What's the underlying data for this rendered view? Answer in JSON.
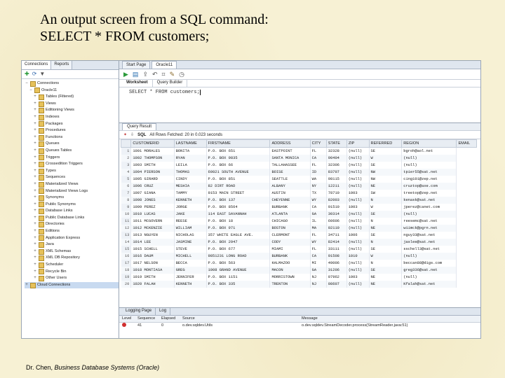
{
  "slide": {
    "title_line1": "An output screen from a SQL command:",
    "title_line2": "SELECT * FROM customers;",
    "footer_author": "Dr. Chen, ",
    "footer_book": "Business Database Systems (Oracle)"
  },
  "left_pane": {
    "tabs": [
      "Connections",
      "Reports"
    ],
    "tree": [
      {
        "label": "Connections",
        "depth": 0,
        "exp": "−"
      },
      {
        "label": "Oracle11",
        "depth": 1,
        "exp": "−"
      },
      {
        "label": "Tables (Filtered)",
        "depth": 2,
        "exp": "+"
      },
      {
        "label": "Views",
        "depth": 2,
        "exp": "+"
      },
      {
        "label": "Editioning Views",
        "depth": 2,
        "exp": "+"
      },
      {
        "label": "Indexes",
        "depth": 2,
        "exp": "+"
      },
      {
        "label": "Packages",
        "depth": 2,
        "exp": "+"
      },
      {
        "label": "Procedures",
        "depth": 2,
        "exp": "+"
      },
      {
        "label": "Functions",
        "depth": 2,
        "exp": "+"
      },
      {
        "label": "Queues",
        "depth": 2,
        "exp": "+"
      },
      {
        "label": "Queues Tables",
        "depth": 2,
        "exp": "+"
      },
      {
        "label": "Triggers",
        "depth": 2,
        "exp": "+"
      },
      {
        "label": "Crossedition Triggers",
        "depth": 2,
        "exp": "+"
      },
      {
        "label": "Types",
        "depth": 2,
        "exp": "+"
      },
      {
        "label": "Sequences",
        "depth": 2,
        "exp": "+"
      },
      {
        "label": "Materialized Views",
        "depth": 2,
        "exp": "+"
      },
      {
        "label": "Materialized Views Logs",
        "depth": 2,
        "exp": "+"
      },
      {
        "label": "Synonyms",
        "depth": 2,
        "exp": "+"
      },
      {
        "label": "Public Synonyms",
        "depth": 2,
        "exp": "+"
      },
      {
        "label": "Database Links",
        "depth": 2,
        "exp": "+"
      },
      {
        "label": "Public Database Links",
        "depth": 2,
        "exp": "+"
      },
      {
        "label": "Directories",
        "depth": 2,
        "exp": "+"
      },
      {
        "label": "Editions",
        "depth": 2,
        "exp": "+"
      },
      {
        "label": "Application Express",
        "depth": 2,
        "exp": "+"
      },
      {
        "label": "Java",
        "depth": 2,
        "exp": "+"
      },
      {
        "label": "XML Schemas",
        "depth": 2,
        "exp": "+"
      },
      {
        "label": "XML DB Repository",
        "depth": 2,
        "exp": "+"
      },
      {
        "label": "Scheduler",
        "depth": 2,
        "exp": "+"
      },
      {
        "label": "Recycle Bin",
        "depth": 2,
        "exp": "+"
      },
      {
        "label": "Other Users",
        "depth": 2,
        "exp": "+"
      },
      {
        "label": "Cloud Connections",
        "depth": 0,
        "exp": "+",
        "selected": true
      }
    ]
  },
  "right_pane": {
    "tabs": [
      "Start Page",
      "Oracle11"
    ],
    "worksheet_tabs": [
      "Worksheet",
      "Query Builder"
    ],
    "sql_text": "SELECT * FROM customers;",
    "result_tab": "Query Result",
    "result_toolbar": {
      "sql_label": "SQL",
      "status": "All Rows Fetched: 20 in 0.023 seconds"
    },
    "columns": [
      "CUSTOMERID",
      "LASTNAME",
      "FIRSTNAME",
      "ADDRESS",
      "CITY",
      "STATE",
      "ZIP",
      "REFERRED",
      "REGION",
      "EMAIL"
    ],
    "rows": [
      [
        "1",
        "1001 MORALES",
        "BONITA",
        "P.O. BOX 651",
        "EASTPOINT",
        "FL",
        "32328",
        "(null)",
        "SE",
        "bgroh@aol.net"
      ],
      [
        "2",
        "1002 THOMPSON",
        "RYAN",
        "P.O. BOX 9835",
        "SANTA MONICA",
        "CA",
        "90404",
        "(null)",
        "W",
        "(null)"
      ],
      [
        "3",
        "1003 SMITH",
        "LEILA",
        "P.O. BOX 66",
        "TALLAHASSEE",
        "FL",
        "32306",
        "(null)",
        "SE",
        "(null)"
      ],
      [
        "4",
        "1004 PIERSON",
        "THOMAS",
        "69821 SOUTH AVENUE",
        "BOISE",
        "ID",
        "83707",
        "(null)",
        "NW",
        "tpier55@sat.net"
      ],
      [
        "5",
        "1005 GIRARD",
        "CINDY",
        "P.O. BOX 851",
        "SEATTLE",
        "WA",
        "98115",
        "(null)",
        "NW",
        "cing101@zep.net"
      ],
      [
        "6",
        "1006 CRUZ",
        "MESHIA",
        "82 DIRT ROAD",
        "ALBANY",
        "NY",
        "12211",
        "(null)",
        "NE",
        "cruztop@axe.com"
      ],
      [
        "7",
        "1007 GIANA",
        "TAMMY",
        "9153 MAIN STREET",
        "AUSTIN",
        "TX",
        "78710",
        "1003",
        "SW",
        "treetop@zep.net"
      ],
      [
        "8",
        "1008 JONES",
        "KENNETH",
        "P.O. BOX 137",
        "CHEYENNE",
        "WY",
        "82003",
        "(null)",
        "N",
        "kenask@sat.net"
      ],
      [
        "9",
        "1009 PEREZ",
        "JORGE",
        "P.O. BOX 8564",
        "BURBANK",
        "CA",
        "91510",
        "1003",
        "W",
        "jperez@canet.com"
      ],
      [
        "10",
        "1010 LUCAS",
        "JAKE",
        "114 EAST SAVANNAH",
        "ATLANTA",
        "GA",
        "30314",
        "(null)",
        "SE",
        "(null)"
      ],
      [
        "11",
        "1011 MCGOVERN",
        "REESE",
        "P.O. BOX 18",
        "CHICAGO",
        "IL",
        "60606",
        "(null)",
        "N",
        "reesemc@sat.net"
      ],
      [
        "12",
        "1012 MCKENZIE",
        "WILLIAM",
        "P.O. BOX 971",
        "BOSTON",
        "MA",
        "02110",
        "(null)",
        "NE",
        "wiimck@pgrn.net"
      ],
      [
        "13",
        "1013 NGUYEN",
        "NICHOLAS",
        "357 WHITE EAGLE AVE.",
        "CLERMONT",
        "FL",
        "34711",
        "1006",
        "SE",
        "nguy33@sat.net"
      ],
      [
        "14",
        "1014 LEE",
        "JASMINE",
        "P.O. BOX 2947",
        "CODY",
        "WY",
        "82414",
        "(null)",
        "N",
        "jaslee@sat.net"
      ],
      [
        "15",
        "1015 SCHELL",
        "STEVE",
        "P.O. BOX 677",
        "MIAMI",
        "FL",
        "33111",
        "(null)",
        "SE",
        "sschell3@sat.net"
      ],
      [
        "16",
        "1016 DAUM",
        "MICHELL",
        "9851231 LONG ROAD",
        "BURBANK",
        "CA",
        "91508",
        "1010",
        "W",
        "(null)"
      ],
      [
        "17",
        "1017 NELSON",
        "BECCA",
        "P.O. BOX 563",
        "KALMAZOO",
        "MI",
        "49006",
        "(null)",
        "N",
        "beccan88@digs.com"
      ],
      [
        "18",
        "1018 MONTIASA",
        "GREG",
        "1008 GRAND AVENUE",
        "MACON",
        "GA",
        "31206",
        "(null)",
        "SE",
        "greg336@sat.net"
      ],
      [
        "19",
        "1019 SMITH",
        "JENNIFER",
        "P.O. BOX 1151",
        "MORRISTOWN",
        "NJ",
        "07962",
        "1003",
        "NE",
        "(null)"
      ],
      [
        "20",
        "1020 FALAH",
        "KENNETH",
        "P.O. BOX 335",
        "TRENTON",
        "NJ",
        "08607",
        "(null)",
        "NE",
        "Kfalah@sat.net"
      ]
    ],
    "log": {
      "tabs": [
        "Logging Page",
        "Log"
      ],
      "headers": [
        "Level",
        "Sequence",
        "Elapsed",
        "Source",
        "Message"
      ],
      "row": [
        "",
        "41",
        "0",
        "o.dev.sqldev.Utils",
        "o.dev.sqldev.StreamDecoder.process(StreamReader.java:51)"
      ]
    }
  }
}
